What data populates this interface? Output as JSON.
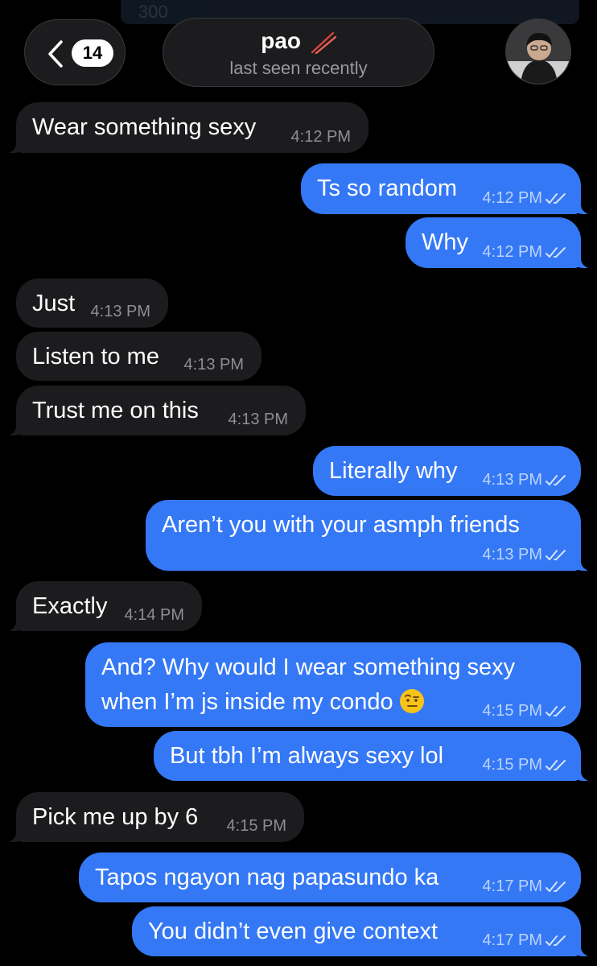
{
  "header": {
    "top_strip_text": "300",
    "back_count": "14",
    "contact_name": "pao",
    "status": "last seen recently"
  },
  "messages": [
    {
      "dir": "in",
      "text": "Wear something sexy",
      "time": "4:12 PM"
    },
    {
      "dir": "out",
      "text": "Ts so random",
      "time": "4:12 PM"
    },
    {
      "dir": "out",
      "text": "Why",
      "time": "4:12 PM"
    },
    {
      "dir": "in",
      "text": "Just",
      "time": "4:13 PM"
    },
    {
      "dir": "in",
      "text": "Listen to me",
      "time": "4:13 PM"
    },
    {
      "dir": "in",
      "text": "Trust me on this",
      "time": "4:13 PM"
    },
    {
      "dir": "out",
      "text": "Literally why",
      "time": "4:13 PM"
    },
    {
      "dir": "out",
      "text": "Aren’t you with your asmph friends",
      "time": "4:13 PM"
    },
    {
      "dir": "in",
      "text": "Exactly",
      "time": "4:14 PM"
    },
    {
      "dir": "out",
      "text": "And? Why would I wear something sexy\nwhen I’m js inside my condo",
      "time": "4:15 PM",
      "emoji": "raised-eyebrow-emoji"
    },
    {
      "dir": "out",
      "text": "But tbh I’m always sexy lol",
      "time": "4:15 PM"
    },
    {
      "dir": "in",
      "text": "Pick me up by 6",
      "time": "4:15 PM"
    },
    {
      "dir": "out",
      "text": "Tapos ngayon nag papasundo ka",
      "time": "4:17 PM"
    },
    {
      "dir": "out",
      "text": "You didn’t even give context",
      "time": "4:17 PM"
    }
  ],
  "colors": {
    "background": "#000000",
    "incoming": "#1c1c1e",
    "outgoing": "#3478f6"
  }
}
